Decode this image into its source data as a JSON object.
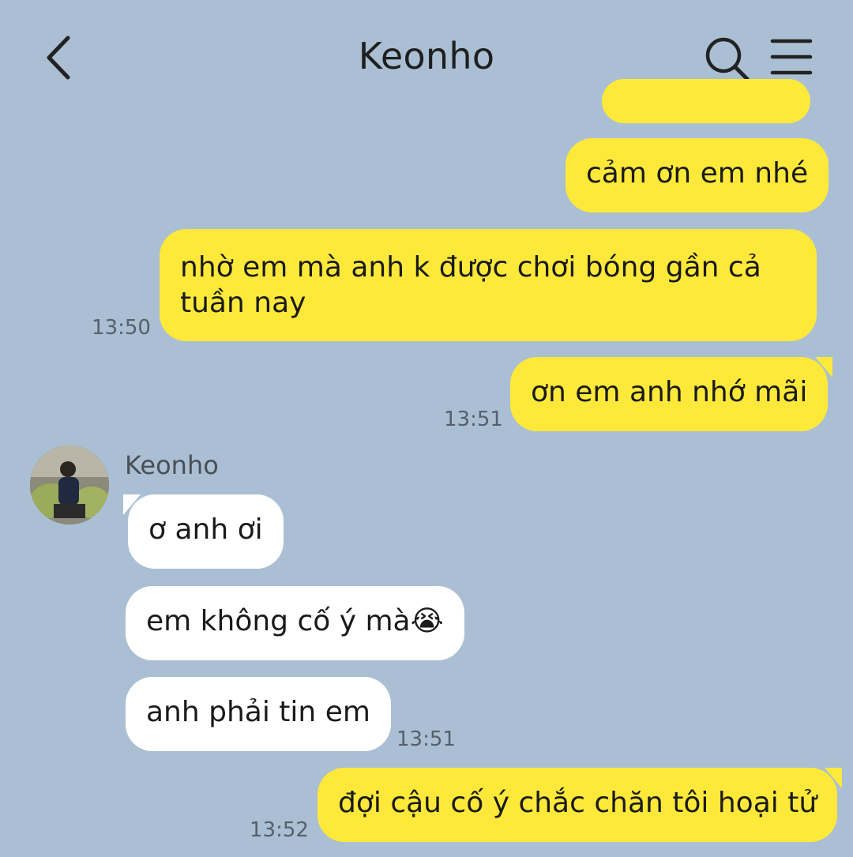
{
  "header": {
    "back_icon": "chevron-left-icon",
    "title": "Keonho",
    "search_icon": "search-icon",
    "menu_icon": "menu-icon"
  },
  "contact": {
    "name": "Keonho"
  },
  "messages": [
    {
      "sender": "me",
      "text": "cảm ơn em nhé",
      "time": ""
    },
    {
      "sender": "me",
      "text": "nhờ em mà anh k được chơi bóng gần cả tuần nay",
      "time": "13:50"
    },
    {
      "sender": "me",
      "text": "ơn em anh nhớ mãi",
      "time": "13:51"
    },
    {
      "sender": "Keonho",
      "text": "ơ anh ơi",
      "time": ""
    },
    {
      "sender": "Keonho",
      "text": "em không cố ý mà😭",
      "time": ""
    },
    {
      "sender": "Keonho",
      "text": "anh phải tin em",
      "time": "13:51"
    },
    {
      "sender": "me",
      "text": "đợi cậu cố ý chắc chăn tôi hoại tử",
      "time": "13:52"
    }
  ],
  "message_lines": {
    "m1_line1": "nhờ em mà anh k được chơi bóng gần cả",
    "m1_line2": "tuần nay"
  },
  "colors": {
    "background": "#aabfd3",
    "outgoing_bubble": "#fee93a",
    "incoming_bubble": "#ffffff"
  }
}
